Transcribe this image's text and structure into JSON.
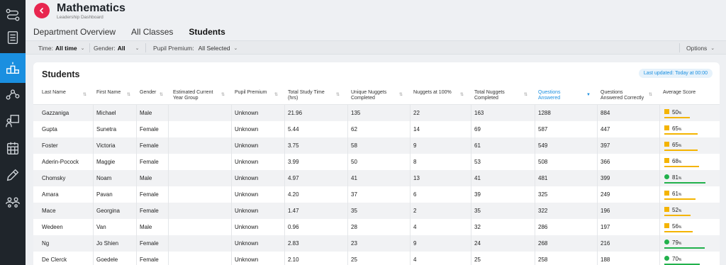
{
  "app": {
    "title": "Mathematics",
    "subtitle": "Leadership Dashboard"
  },
  "sidebar": {
    "items": [
      {
        "icon": "flow-icon",
        "active": false
      },
      {
        "icon": "list-icon",
        "active": false
      },
      {
        "icon": "podium-icon",
        "active": true
      },
      {
        "icon": "network-icon",
        "active": false
      },
      {
        "icon": "presenter-icon",
        "active": false
      },
      {
        "icon": "calendar-icon",
        "active": false
      },
      {
        "icon": "pencil-icon",
        "active": false
      },
      {
        "icon": "group-icon",
        "active": false
      }
    ]
  },
  "tabs": [
    {
      "label": "Department Overview",
      "active": false
    },
    {
      "label": "All Classes",
      "active": false
    },
    {
      "label": "Students",
      "active": true
    }
  ],
  "filters": {
    "time_label": "Time:",
    "time_value": "All time",
    "gender_label": "Gender:",
    "gender_value": "All",
    "premium_label": "Pupil Premium:",
    "premium_value": "All Selected",
    "options_label": "Options"
  },
  "card": {
    "title": "Students",
    "updated": "Last updated: Today at 00:00"
  },
  "colors": {
    "accent": "#e8264f",
    "blue": "#1a8fe0",
    "amber": "#f4b400",
    "green": "#22b14c"
  },
  "table": {
    "columns": [
      "Last Name",
      "First Name",
      "Gender",
      "Estimated Current Year Group",
      "Pupil Premium",
      "Total Study Time (hrs)",
      "Unique Nuggets Completed",
      "Nuggets at 100%",
      "Total Nuggets Completed",
      "Questions Answered",
      "Questions Answered Correctly",
      "Average Score"
    ],
    "sorted_column": "Questions Answered",
    "rows": [
      {
        "last": "Gazzaniga",
        "first": "Michael",
        "gender": "Male",
        "year": "",
        "premium": "Unknown",
        "study": "21.96",
        "unique": "135",
        "full": "22",
        "total": "163",
        "answered": "1288",
        "correct": "884",
        "score": 50,
        "band": "amber"
      },
      {
        "last": "Gupta",
        "first": "Sunetra",
        "gender": "Female",
        "year": "",
        "premium": "Unknown",
        "study": "5.44",
        "unique": "62",
        "full": "14",
        "total": "69",
        "answered": "587",
        "correct": "447",
        "score": 65,
        "band": "amber"
      },
      {
        "last": "Foster",
        "first": "Victoria",
        "gender": "Female",
        "year": "",
        "premium": "Unknown",
        "study": "3.75",
        "unique": "58",
        "full": "9",
        "total": "61",
        "answered": "549",
        "correct": "397",
        "score": 65,
        "band": "amber"
      },
      {
        "last": "Aderin-Pocock",
        "first": "Maggie",
        "gender": "Female",
        "year": "",
        "premium": "Unknown",
        "study": "3.99",
        "unique": "50",
        "full": "8",
        "total": "53",
        "answered": "508",
        "correct": "366",
        "score": 68,
        "band": "amber"
      },
      {
        "last": "Chomsky",
        "first": "Noam",
        "gender": "Male",
        "year": "",
        "premium": "Unknown",
        "study": "4.97",
        "unique": "41",
        "full": "13",
        "total": "41",
        "answered": "481",
        "correct": "399",
        "score": 81,
        "band": "green"
      },
      {
        "last": "Amara",
        "first": "Pavan",
        "gender": "Female",
        "year": "",
        "premium": "Unknown",
        "study": "4.20",
        "unique": "37",
        "full": "6",
        "total": "39",
        "answered": "325",
        "correct": "249",
        "score": 61,
        "band": "amber"
      },
      {
        "last": "Mace",
        "first": "Georgina",
        "gender": "Female",
        "year": "",
        "premium": "Unknown",
        "study": "1.47",
        "unique": "35",
        "full": "2",
        "total": "35",
        "answered": "322",
        "correct": "196",
        "score": 52,
        "band": "amber"
      },
      {
        "last": "Wedeen",
        "first": "Van",
        "gender": "Male",
        "year": "",
        "premium": "Unknown",
        "study": "0.96",
        "unique": "28",
        "full": "4",
        "total": "32",
        "answered": "286",
        "correct": "197",
        "score": 56,
        "band": "amber"
      },
      {
        "last": "Ng",
        "first": "Jo Shien",
        "gender": "Female",
        "year": "",
        "premium": "Unknown",
        "study": "2.83",
        "unique": "23",
        "full": "9",
        "total": "24",
        "answered": "268",
        "correct": "216",
        "score": 79,
        "band": "green"
      },
      {
        "last": "De Clerck",
        "first": "Goedele",
        "gender": "Female",
        "year": "",
        "premium": "Unknown",
        "study": "2.10",
        "unique": "25",
        "full": "4",
        "total": "25",
        "answered": "258",
        "correct": "188",
        "score": 70,
        "band": "green"
      }
    ]
  }
}
